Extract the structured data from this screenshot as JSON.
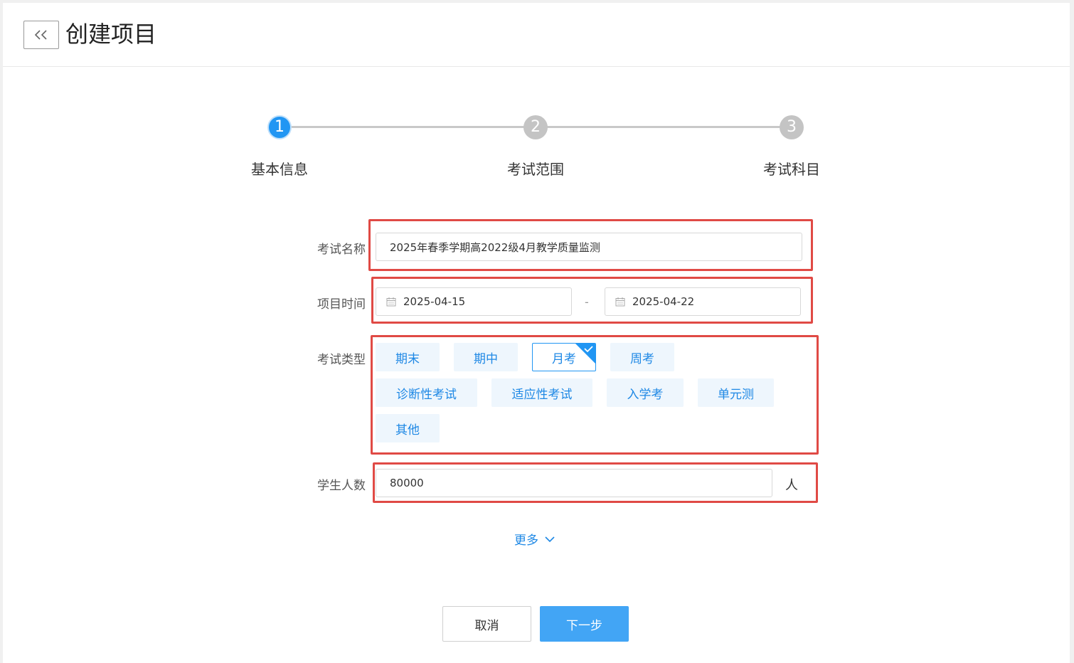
{
  "header": {
    "back_label": "<<",
    "title": "创建项目"
  },
  "steps": [
    {
      "number": "1",
      "label": "基本信息",
      "active": true
    },
    {
      "number": "2",
      "label": "考试范围",
      "active": false
    },
    {
      "number": "3",
      "label": "考试科目",
      "active": false
    }
  ],
  "form": {
    "exam_name": {
      "label": "考试名称",
      "value": "2025年春季学期高2022级4月教学质量监测"
    },
    "project_time": {
      "label": "项目时间",
      "start": "2025-04-15",
      "separator": "-",
      "end": "2025-04-22"
    },
    "exam_type": {
      "label": "考试类型",
      "options": [
        "期末",
        "期中",
        "月考",
        "周考",
        "诊断性考试",
        "适应性考试",
        "入学考",
        "单元测",
        "其他"
      ],
      "selected": "月考"
    },
    "student_count": {
      "label": "学生人数",
      "value": "80000",
      "unit": "人"
    }
  },
  "more_label": "更多",
  "actions": {
    "cancel": "取消",
    "next": "下一步"
  },
  "colors": {
    "primary": "#2196f3",
    "highlight_box": "#e04a45",
    "chip_bg": "#eef6fd"
  }
}
